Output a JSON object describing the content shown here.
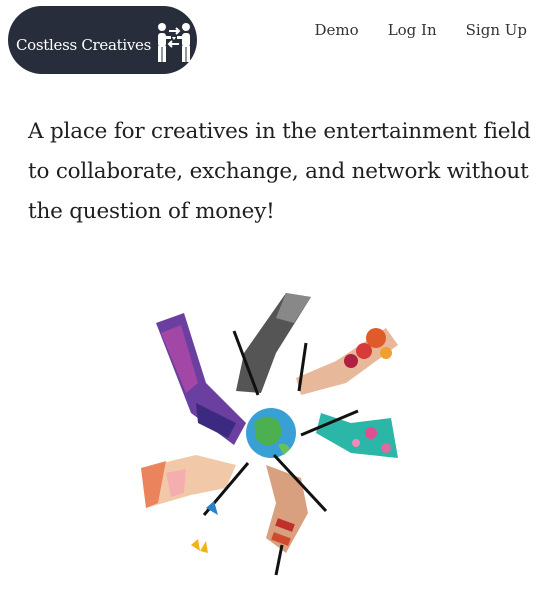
{
  "brand": {
    "name": "Costless Creatives",
    "logo_bg": "#272d3a",
    "icon": "two-people-exchange-icon"
  },
  "nav": {
    "items": [
      {
        "label": "Demo"
      },
      {
        "label": "Log In"
      },
      {
        "label": "Sign Up"
      }
    ]
  },
  "hero": {
    "headline": "A place for creatives in the entertainment field to collaborate, exchange, and network without the question of money!",
    "image": "hands-drawing-around-globe-illustration"
  }
}
